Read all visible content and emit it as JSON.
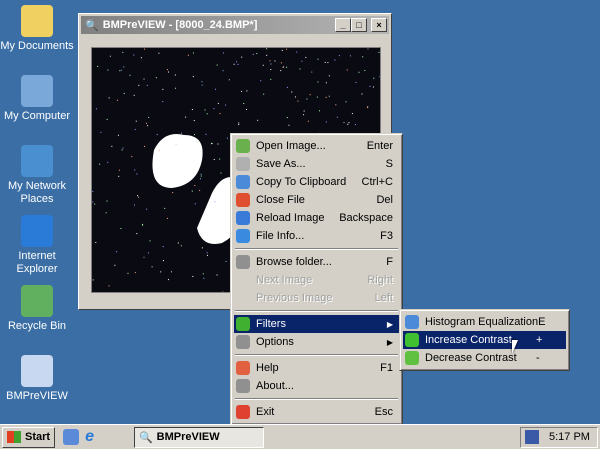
{
  "desktop": [
    {
      "label": "My Documents",
      "color": "#f0d060"
    },
    {
      "label": "My Computer",
      "color": "#7aa8d8"
    },
    {
      "label": "My Network Places",
      "color": "#4a90d0"
    },
    {
      "label": "Internet Explorer",
      "color": "#2a7ad8"
    },
    {
      "label": "Recycle Bin",
      "color": "#60b060"
    },
    {
      "label": "BMPreVIEW",
      "color": "#c8d8f0"
    }
  ],
  "window": {
    "title": "BMPreVIEW - [8000_24.BMP*]",
    "min": "_",
    "max": "□",
    "close": "×"
  },
  "menu": [
    {
      "label": "Open Image...",
      "key": "Enter",
      "color": "#6ab04c"
    },
    {
      "label": "Save As...",
      "key": "S",
      "color": "#b0b0b0"
    },
    {
      "label": "Copy To Clipboard",
      "key": "Ctrl+C",
      "color": "#4a8ad8"
    },
    {
      "label": "Close File",
      "key": "Del",
      "color": "#e05030"
    },
    {
      "label": "Reload Image",
      "key": "Backspace",
      "color": "#3a7ad8"
    },
    {
      "label": "File Info...",
      "key": "F3",
      "color": "#3a8ae0"
    },
    {
      "label": "Browse folder...",
      "key": "F",
      "color": "#909090"
    },
    {
      "label": "Next Image",
      "key": "Right"
    },
    {
      "label": "Previous Image",
      "key": "Left"
    },
    {
      "label": "Filters",
      "key": "",
      "color": "#40b030"
    },
    {
      "label": "Options",
      "key": "",
      "color": "#909090"
    },
    {
      "label": "Help",
      "key": "F1",
      "color": "#e06040"
    },
    {
      "label": "About...",
      "key": "",
      "color": "#909090"
    },
    {
      "label": "Exit",
      "key": "Esc",
      "color": "#e04030"
    }
  ],
  "submenu": [
    {
      "label": "Histogram Equalization",
      "key": "E",
      "color": "#4a8ad8"
    },
    {
      "label": "Increase Contrast",
      "key": "+",
      "color": "#40c030"
    },
    {
      "label": "Decrease Contrast",
      "key": "-",
      "color": "#60c040"
    }
  ],
  "taskbar": {
    "start": "Start",
    "task": "BMPreVIEW",
    "clock": "5:17 PM"
  }
}
